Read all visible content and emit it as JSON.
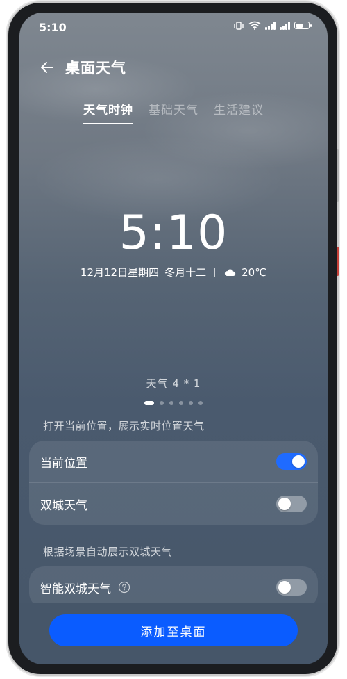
{
  "status_bar": {
    "time": "5:10",
    "battery_level": 0.6
  },
  "header": {
    "title": "桌面天气"
  },
  "tabs": [
    {
      "label": "天气时钟",
      "active": true
    },
    {
      "label": "基础天气",
      "active": false
    },
    {
      "label": "生活建议",
      "active": false
    }
  ],
  "preview": {
    "time": "5:10",
    "date": "12月12日星期四",
    "lunar": "冬月十二",
    "temperature": "20℃",
    "weather_icon": "cloudy-icon",
    "widget_size": "天气 4 * 1",
    "page_count": 6,
    "current_page": 1
  },
  "location_section": {
    "label": "打开当前位置，展示实时位置天气",
    "items": [
      {
        "label": "当前位置",
        "enabled": true
      },
      {
        "label": "双城天气",
        "enabled": false
      }
    ]
  },
  "scene_section": {
    "label": "根据场景自动展示双城天气",
    "items": [
      {
        "label": "智能双城天气",
        "enabled": false
      }
    ]
  },
  "add_button": {
    "label": "添加至桌面"
  },
  "colors": {
    "accent": "#0a5cff",
    "toggle_on": "#1f6bff"
  }
}
